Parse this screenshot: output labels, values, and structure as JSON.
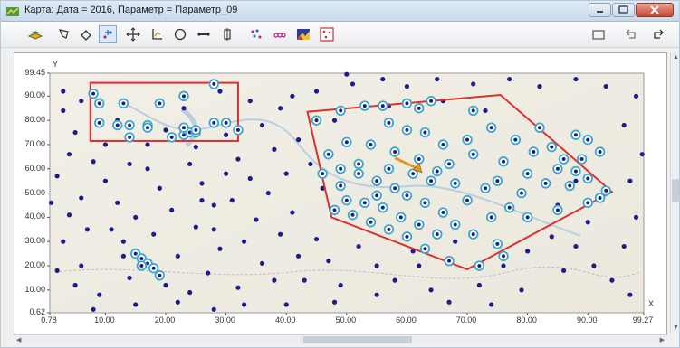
{
  "window": {
    "title": "Карта: Дата = 2016, Параметр = Параметр_09",
    "icon": "map-app-icon"
  },
  "toolbar": {
    "buttons": [
      {
        "name": "layers-tool-icon"
      },
      {
        "name": "lasso-select-icon"
      },
      {
        "name": "eraser-icon"
      },
      {
        "name": "add-points-icon",
        "active": true
      },
      {
        "name": "pan-move-icon"
      },
      {
        "name": "axes-icon"
      },
      {
        "name": "circle-select-icon"
      },
      {
        "name": "horizontal-measure-icon"
      },
      {
        "name": "vertical-measure-icon"
      },
      {
        "name": "scatter-icon"
      },
      {
        "name": "labels-icon"
      },
      {
        "name": "color-map-icon"
      },
      {
        "name": "grid-points-icon"
      }
    ],
    "right_buttons": [
      {
        "name": "window-icon"
      },
      {
        "name": "undo-icon"
      },
      {
        "name": "redo-icon"
      }
    ]
  },
  "chart_data": {
    "type": "scatter",
    "x_ticks": [
      "0.78",
      "10.00",
      "20.00",
      "30.00",
      "40.00",
      "50.00",
      "60.00",
      "70.00",
      "80.00",
      "90.00",
      "99.27"
    ],
    "y_ticks": [
      "0.62",
      "10.00",
      "20.00",
      "30.00",
      "40.00",
      "50.00",
      "60.00",
      "70.00",
      "80.00",
      "90.00",
      "99.45"
    ],
    "xlim": [
      0.78,
      99.27
    ],
    "ylim": [
      0.62,
      99.45
    ],
    "xlabel": "X",
    "ylabel": "Y",
    "point_color": "#1b1d8a",
    "highlight_color": "#3fa7c9",
    "region_color": "#d93030",
    "rectangle_region": {
      "x": [
        7.5,
        32.0
      ],
      "y": [
        71.5,
        95.5
      ]
    },
    "polygon_region": [
      [
        43.5,
        83.5
      ],
      [
        75.5,
        90.5
      ],
      [
        94.0,
        50.5
      ],
      [
        70.0,
        18.5
      ],
      [
        47.5,
        40.0
      ]
    ],
    "arrow": {
      "from": [
        58.0,
        64.5
      ],
      "to": [
        62.5,
        58.5
      ],
      "color": "#e09a1f"
    },
    "points_regular": [
      [
        3,
        92
      ],
      [
        5,
        75
      ],
      [
        2,
        57
      ],
      [
        4,
        41
      ],
      [
        3,
        30
      ],
      [
        6,
        20
      ],
      [
        5,
        12
      ],
      [
        8,
        63
      ],
      [
        10,
        55
      ],
      [
        12,
        46
      ],
      [
        11,
        35
      ],
      [
        13,
        24
      ],
      [
        14,
        15
      ],
      [
        9,
        8
      ],
      [
        17,
        60
      ],
      [
        19,
        52
      ],
      [
        21,
        43
      ],
      [
        18,
        33
      ],
      [
        22,
        24
      ],
      [
        20,
        12
      ],
      [
        24,
        62
      ],
      [
        26,
        54
      ],
      [
        28,
        45
      ],
      [
        25,
        36
      ],
      [
        29,
        27
      ],
      [
        27,
        17
      ],
      [
        24,
        9
      ],
      [
        32,
        64
      ],
      [
        34,
        56
      ],
      [
        31,
        47
      ],
      [
        35,
        39
      ],
      [
        33,
        30
      ],
      [
        36,
        21
      ],
      [
        32,
        11
      ],
      [
        38,
        68
      ],
      [
        40,
        58
      ],
      [
        37,
        50
      ],
      [
        41,
        42
      ],
      [
        39,
        33
      ],
      [
        42,
        24
      ],
      [
        38,
        14
      ],
      [
        36,
        78
      ],
      [
        39,
        85
      ],
      [
        42,
        72
      ],
      [
        45,
        92
      ],
      [
        48,
        80
      ],
      [
        34,
        88
      ],
      [
        30,
        74
      ],
      [
        44,
        62
      ],
      [
        46,
        52
      ],
      [
        45,
        31
      ],
      [
        47,
        22
      ],
      [
        49,
        12
      ],
      [
        52,
        28
      ],
      [
        55,
        20
      ],
      [
        58,
        14
      ],
      [
        61,
        26
      ],
      [
        64,
        10
      ],
      [
        67,
        5
      ],
      [
        72,
        12
      ],
      [
        76,
        20
      ],
      [
        80,
        26
      ],
      [
        84,
        32
      ],
      [
        88,
        28
      ],
      [
        91,
        20
      ],
      [
        94,
        14
      ],
      [
        97,
        8
      ],
      [
        96,
        28
      ],
      [
        98,
        40
      ],
      [
        97,
        55
      ],
      [
        99,
        66
      ],
      [
        96,
        78
      ],
      [
        98,
        90
      ],
      [
        93,
        94
      ],
      [
        88,
        97
      ],
      [
        82,
        94
      ],
      [
        77,
        97
      ],
      [
        71,
        95
      ],
      [
        65,
        97
      ],
      [
        60,
        94
      ],
      [
        56,
        97
      ],
      [
        51,
        95
      ],
      [
        62,
        20
      ],
      [
        55,
        8
      ],
      [
        48,
        5
      ],
      [
        43,
        14
      ],
      [
        40,
        4
      ],
      [
        33,
        4
      ],
      [
        28,
        2
      ],
      [
        22,
        5
      ],
      [
        15,
        4
      ],
      [
        8,
        2
      ],
      [
        2,
        18
      ],
      [
        6,
        88
      ],
      [
        14,
        62
      ],
      [
        17,
        70
      ],
      [
        25,
        69
      ],
      [
        20,
        76
      ],
      [
        23,
        85
      ],
      [
        29,
        92
      ],
      [
        12,
        80
      ],
      [
        3,
        84
      ],
      [
        10,
        70
      ],
      [
        85,
        45
      ],
      [
        88,
        55
      ],
      [
        90,
        38
      ],
      [
        86,
        18
      ],
      [
        79,
        10
      ],
      [
        74,
        4
      ],
      [
        68,
        30
      ],
      [
        41,
        90
      ],
      [
        50,
        99
      ],
      [
        57,
        86
      ],
      [
        66,
        88
      ],
      [
        73,
        84
      ],
      [
        28,
        35
      ],
      [
        26,
        47
      ],
      [
        30,
        58
      ],
      [
        15,
        40
      ],
      [
        13,
        30
      ],
      [
        7,
        35
      ],
      [
        4,
        66
      ],
      [
        1,
        46
      ],
      [
        6,
        48
      ]
    ],
    "points_highlighted": [
      [
        8,
        91
      ],
      [
        9,
        87
      ],
      [
        13,
        87
      ],
      [
        9,
        79
      ],
      [
        12,
        78
      ],
      [
        14,
        78
      ],
      [
        19,
        87
      ],
      [
        23,
        90
      ],
      [
        28,
        95
      ],
      [
        17,
        78
      ],
      [
        21,
        73
      ],
      [
        23,
        74
      ],
      [
        24,
        75
      ],
      [
        25,
        75
      ],
      [
        25,
        76
      ],
      [
        28,
        79
      ],
      [
        30,
        79
      ],
      [
        32,
        76
      ],
      [
        23,
        77
      ],
      [
        14,
        73
      ],
      [
        17,
        77
      ],
      [
        15,
        25
      ],
      [
        16,
        23
      ],
      [
        17,
        21
      ],
      [
        16,
        20
      ],
      [
        18,
        19
      ],
      [
        19,
        16
      ],
      [
        45,
        80
      ],
      [
        49,
        84
      ],
      [
        53,
        86
      ],
      [
        56,
        86
      ],
      [
        60,
        87
      ],
      [
        62,
        85
      ],
      [
        64,
        88
      ],
      [
        71,
        84
      ],
      [
        82,
        77
      ],
      [
        88,
        74
      ],
      [
        90,
        72
      ],
      [
        92,
        67
      ],
      [
        89,
        64
      ],
      [
        85,
        60
      ],
      [
        88,
        59
      ],
      [
        90,
        56
      ],
      [
        87,
        53
      ],
      [
        90,
        46
      ],
      [
        85,
        43
      ],
      [
        80,
        40
      ],
      [
        77,
        44
      ],
      [
        74,
        40
      ],
      [
        70,
        47
      ],
      [
        73,
        52
      ],
      [
        68,
        54
      ],
      [
        65,
        59
      ],
      [
        62,
        64
      ],
      [
        58,
        67
      ],
      [
        54,
        70
      ],
      [
        50,
        71
      ],
      [
        47,
        66
      ],
      [
        49,
        60
      ],
      [
        52,
        58
      ],
      [
        55,
        55
      ],
      [
        58,
        52
      ],
      [
        60,
        49
      ],
      [
        63,
        46
      ],
      [
        66,
        42
      ],
      [
        68,
        37
      ],
      [
        71,
        33
      ],
      [
        75,
        29
      ],
      [
        76,
        24
      ],
      [
        72,
        20
      ],
      [
        67,
        22
      ],
      [
        63,
        27
      ],
      [
        60,
        32
      ],
      [
        57,
        35
      ],
      [
        54,
        38
      ],
      [
        51,
        41
      ],
      [
        48,
        43
      ],
      [
        50,
        47
      ],
      [
        53,
        46
      ],
      [
        56,
        44
      ],
      [
        59,
        40
      ],
      [
        62,
        37
      ],
      [
        65,
        33
      ],
      [
        57,
        60
      ],
      [
        61,
        58
      ],
      [
        64,
        55
      ],
      [
        67,
        62
      ],
      [
        71,
        66
      ],
      [
        76,
        63
      ],
      [
        80,
        58
      ],
      [
        83,
        54
      ],
      [
        79,
        50
      ],
      [
        75,
        55
      ],
      [
        52,
        62
      ],
      [
        55,
        49
      ],
      [
        49,
        53
      ],
      [
        46,
        58
      ],
      [
        60,
        76
      ],
      [
        57,
        79
      ],
      [
        63,
        75
      ],
      [
        66,
        70
      ],
      [
        70,
        72
      ],
      [
        74,
        77
      ],
      [
        78,
        72
      ],
      [
        81,
        67
      ],
      [
        84,
        69
      ],
      [
        86,
        64
      ],
      [
        92,
        48
      ],
      [
        93,
        51
      ]
    ]
  }
}
